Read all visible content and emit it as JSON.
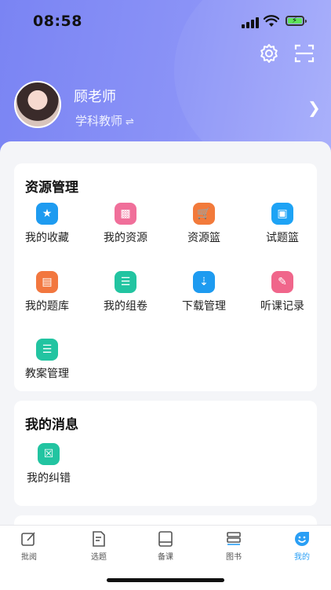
{
  "status_bar": {
    "time": "08:58"
  },
  "profile": {
    "name": "顾老师",
    "role": "学科教师",
    "switch_glyph": "⇌"
  },
  "resource_section": {
    "title": "资源管理",
    "items": [
      {
        "label": "我的收藏",
        "icon": "star-icon",
        "color": "#1e9bf0"
      },
      {
        "label": "我的资源",
        "icon": "folder-icon",
        "color": "#f06f9a"
      },
      {
        "label": "资源篮",
        "icon": "cart-icon",
        "color": "#f27a3b"
      },
      {
        "label": "试题篮",
        "icon": "basket-icon",
        "color": "#1ea3f5"
      },
      {
        "label": "我的题库",
        "icon": "question-bank-icon",
        "color": "#f2773f"
      },
      {
        "label": "我的组卷",
        "icon": "paper-list-icon",
        "color": "#22c4a1"
      },
      {
        "label": "下载管理",
        "icon": "download-icon",
        "color": "#1e9bf0"
      },
      {
        "label": "听课记录",
        "icon": "edit-note-icon",
        "color": "#f0668b"
      },
      {
        "label": "教案管理",
        "icon": "lesson-plan-icon",
        "color": "#22c4a1"
      }
    ]
  },
  "message_section": {
    "title": "我的消息",
    "items": [
      {
        "label": "我的纠错",
        "icon": "correction-icon",
        "color": "#22c4a1"
      }
    ]
  },
  "tabbar": {
    "items": [
      {
        "label": "批阅",
        "icon": "review-icon",
        "active": false
      },
      {
        "label": "选题",
        "icon": "select-question-icon",
        "active": false
      },
      {
        "label": "备课",
        "icon": "prepare-lesson-icon",
        "active": false
      },
      {
        "label": "图书",
        "icon": "books-icon",
        "active": false
      },
      {
        "label": "我的",
        "icon": "me-icon",
        "active": true
      }
    ],
    "active_color": "#2a9ff5"
  }
}
